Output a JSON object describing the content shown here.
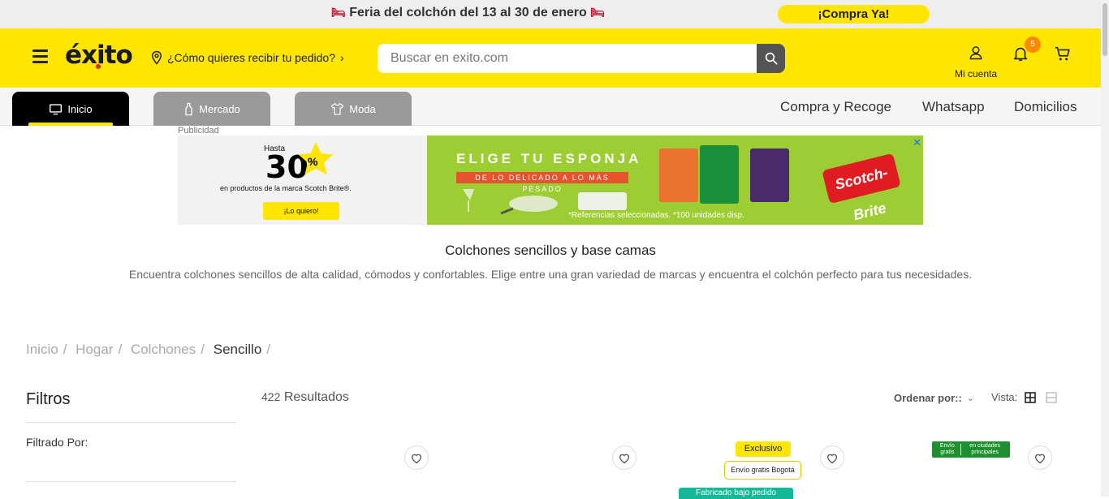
{
  "promo": {
    "text": "Feria del colchón del 13 al 30 de enero",
    "cta": "¡Compra Ya!"
  },
  "header": {
    "logo": "éxito",
    "delivery": "¿Cómo quieres recibir tu pedido?",
    "search_placeholder": "Buscar en exito.com",
    "account_label": "Mi cuenta",
    "notifications_count": "5"
  },
  "nav": {
    "tabs": [
      {
        "label": "Inicio"
      },
      {
        "label": "Mercado"
      },
      {
        "label": "Moda"
      }
    ],
    "links": [
      "Compra y Recoge",
      "Whatsapp",
      "Domicilios"
    ]
  },
  "ad": {
    "label": "Publicidad",
    "hasta": "Hasta",
    "discount": "30",
    "pct": "%",
    "subtitle": "en productos de la marca Scotch Brite®.",
    "button": "¡Lo quiero!",
    "headline": "ELIGE TU ESPONJA",
    "ribbon": "DE LO DELICADO A LO MÁS PESADO",
    "note": "*Referencias seleccionadas. *100 unidades disp.",
    "brand": "Scotch-Brite"
  },
  "page": {
    "title": "Colchones sencillos y base camas",
    "description": "Encuentra colchones sencillos de alta calidad, cómodos y confortables. Elige entre una gran variedad de marcas y encuentra el colchón perfecto para tus necesidades."
  },
  "breadcrumb": [
    "Inicio",
    "Hogar",
    "Colchones",
    "Sencillo"
  ],
  "filters": {
    "title": "Filtros",
    "filtered_by": "Filtrado Por:"
  },
  "results": {
    "count": "422",
    "label": "Resultados"
  },
  "sort": {
    "label": "Ordenar por::"
  },
  "view": {
    "label": "Vista:"
  },
  "badges": {
    "exclusivo": "Exclusivo",
    "envio_bogota": "Envío gratis Bogotá",
    "envio_gratis": "Envío gratis",
    "ciudades": "en ciudades principales",
    "fabricado": "Fabricado bajo pedido"
  },
  "colors": {
    "brand_yellow": "#ffe600",
    "badge_orange": "#ff8a00",
    "ad_green": "#9ccd33",
    "brand_red": "#e11b22"
  }
}
